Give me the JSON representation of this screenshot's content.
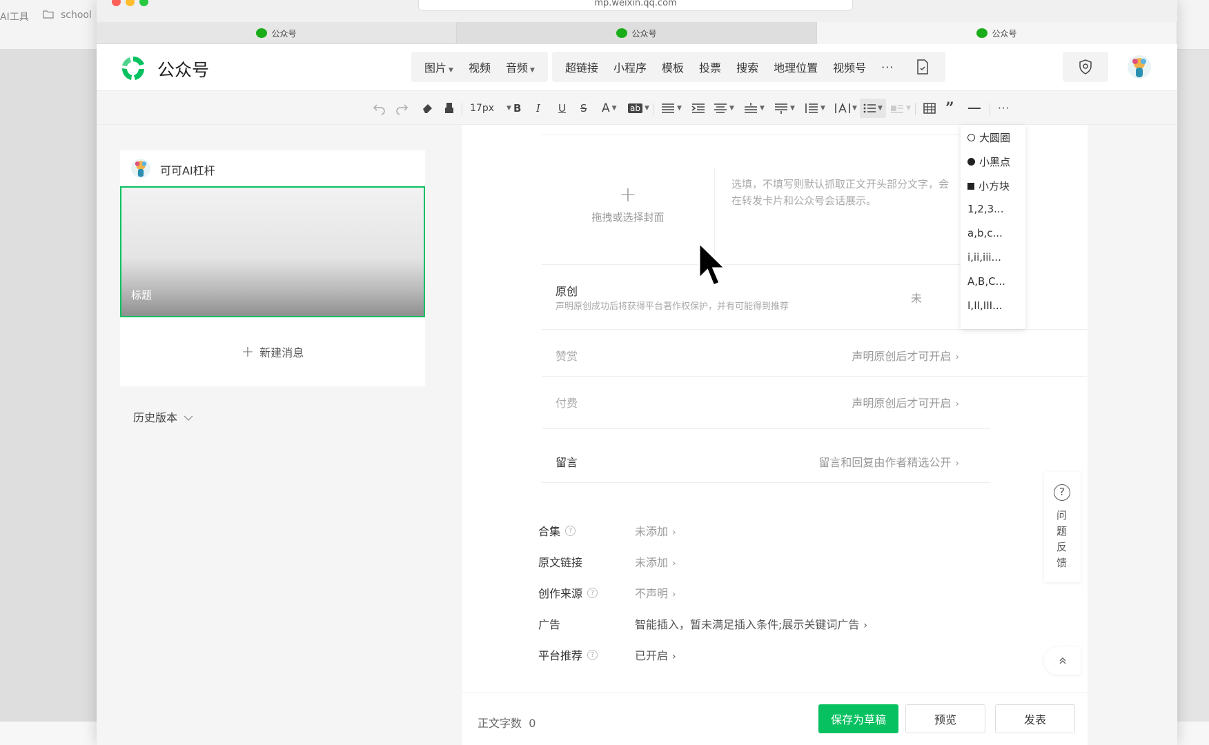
{
  "browser": {
    "bookmarks": [
      "AI工具",
      "school"
    ],
    "url": "mp.weixin.qq.com",
    "tabs": [
      "公众号",
      "公众号",
      "公众号"
    ]
  },
  "header": {
    "brand": "公众号",
    "insert_group1": [
      "图片",
      "视频",
      "音频"
    ],
    "insert_group2": [
      "超链接",
      "小程序",
      "模板",
      "投票",
      "搜索",
      "地理位置",
      "视频号"
    ],
    "more": "···",
    "icons": [
      "document-check-icon",
      "shield-icon",
      "avatar"
    ]
  },
  "toolbar": {
    "font_size": "17px",
    "bold": "B",
    "italic": "I",
    "underline": "U",
    "strike": "S",
    "font_color": "A",
    "bg_color": "ab",
    "more": "···"
  },
  "list_dropdown": {
    "items": [
      "大圆圈",
      "小黑点",
      "小方块",
      "1,2,3...",
      "a,b,c...",
      "i,ii,iii...",
      "A,B,C...",
      "I,II,III..."
    ]
  },
  "left_panel": {
    "account_name": "可可AI杠杆",
    "card_title": "标题",
    "new_message": "新建消息",
    "history": "历史版本"
  },
  "main": {
    "cover_label": "拖拽或选择封面",
    "summary_placeholder": "选填，不填写则默认抓取正文开头部分文字，会在转发卡片和公众号会话展示。",
    "original": {
      "label": "原创",
      "sub": "声明原创成功后将获得平台著作权保护，并有可能得到推荐",
      "value": "未"
    },
    "reward": {
      "label": "赞赏",
      "value": "声明原创后才可开启"
    },
    "paid": {
      "label": "付费",
      "value": "声明原创后才可开启"
    },
    "comment": {
      "label": "留言",
      "value": "留言和回复由作者精选公开"
    },
    "settings": [
      {
        "label": "合集",
        "help": true,
        "value": "未添加"
      },
      {
        "label": "原文链接",
        "help": false,
        "value": "未添加"
      },
      {
        "label": "创作来源",
        "help": true,
        "value": "不声明"
      },
      {
        "label": "广告",
        "help": false,
        "value": "智能插入，暂未满足插入条件;展示关键词广告"
      },
      {
        "label": "平台推荐",
        "help": true,
        "value": "已开启"
      }
    ]
  },
  "footer": {
    "word_count_label": "正文字数",
    "word_count": "0",
    "save_draft": "保存为草稿",
    "preview": "预览",
    "publish": "发表"
  },
  "feedback": {
    "label": "问题反馈",
    "icon": "?"
  },
  "colors": {
    "accent": "#07c160",
    "wechat_green": "#1aad19"
  }
}
